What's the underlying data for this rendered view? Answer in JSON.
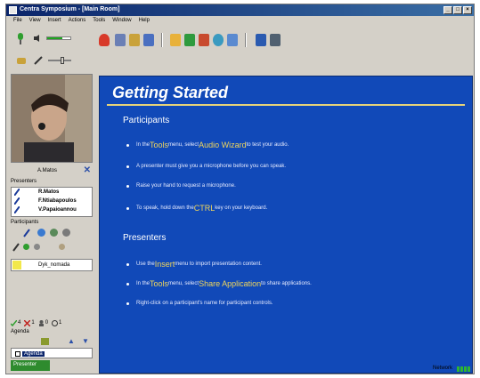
{
  "window": {
    "title": "Centra Symposium - [Main Room]"
  },
  "menu": [
    "File",
    "View",
    "Insert",
    "Actions",
    "Tools",
    "Window",
    "Help"
  ],
  "audio": {
    "input_level_fraction": 0.65
  },
  "participant_panel": {
    "current_user": "A.Matos",
    "presenters_label": "Presenters",
    "presenters": [
      "R.Matos",
      "F.Ntiabapoulos",
      "V.Papaioannou"
    ],
    "participants_label": "Participants",
    "participant_name": "Dyk_nomada",
    "counts": [
      {
        "icon": "check-icon",
        "color": "#2f9e2f",
        "value": "4"
      },
      {
        "icon": "x-icon",
        "color": "#c0201c",
        "value": "1"
      },
      {
        "icon": "person-icon",
        "color": "#555555",
        "value": "0"
      },
      {
        "icon": "clock-icon",
        "color": "#333333",
        "value": "1"
      }
    ],
    "agenda_label": "Agenda",
    "agenda_item": "Agenda",
    "start_button": "Presenter"
  },
  "content": {
    "title": "Getting Started",
    "participants_heading": "Participants",
    "participants_bullets": [
      {
        "pre": "In the ",
        "kw": "Tools",
        "mid": " menu, select ",
        "kw2": "Audio Wizard",
        "post": " to test your audio."
      },
      {
        "pre": "A presenter must give you a microphone before you can speak.",
        "kw": "",
        "mid": "",
        "kw2": "",
        "post": ""
      },
      {
        "pre": "Raise your hand to request a microphone.",
        "kw": "",
        "mid": "",
        "kw2": "",
        "post": ""
      },
      {
        "pre": "To speak, hold down the ",
        "kw": "CTRL",
        "mid": " key on your keyboard.",
        "kw2": "",
        "post": ""
      }
    ],
    "presenters_heading": "Presenters",
    "presenters_bullets": [
      {
        "pre": "Use the ",
        "kw": "Insert",
        "mid": " menu to import presentation content.",
        "kw2": "",
        "post": ""
      },
      {
        "pre": "In the ",
        "kw": "Tools",
        "mid": " menu, select ",
        "kw2": "Share Application",
        "post": " to share applications."
      },
      {
        "pre": "Right-click on a participant's name for participant controls.",
        "kw": "",
        "mid": "",
        "kw2": "",
        "post": ""
      }
    ]
  },
  "status": {
    "network_label": "Network"
  },
  "colors": {
    "content_bg": "#1149b8",
    "keyword": "#f1d65b",
    "rule": "#e6d37a"
  }
}
